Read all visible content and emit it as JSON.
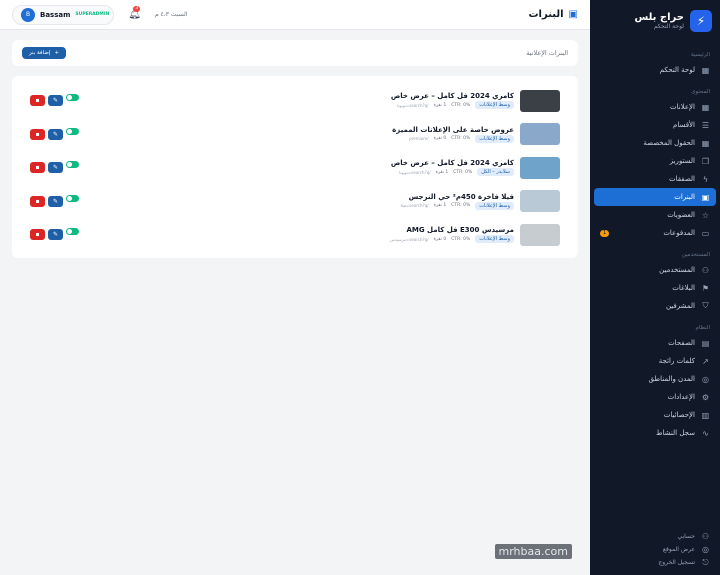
{
  "brand": {
    "name": "حراج بلس",
    "subtitle": "لوحة التحكم"
  },
  "sidebar": {
    "sections": [
      {
        "label": "الرئيسية",
        "items": [
          {
            "label": "لوحة التحكم",
            "icon": "grid-icon"
          }
        ]
      },
      {
        "label": "المحتوى",
        "items": [
          {
            "label": "الإعلانات",
            "icon": "grid-icon"
          },
          {
            "label": "الأقسام",
            "icon": "list-icon"
          },
          {
            "label": "الحقول المخصصة",
            "icon": "grid-icon"
          },
          {
            "label": "الستوريز",
            "icon": "book-icon"
          },
          {
            "label": "الصفقات",
            "icon": "lightning-icon"
          },
          {
            "label": "البنرات",
            "icon": "image-icon",
            "active": true
          },
          {
            "label": "العضويات",
            "icon": "star-icon"
          },
          {
            "label": "المدفوعات",
            "icon": "card-icon",
            "badge": "1"
          }
        ]
      },
      {
        "label": "المستخدمين",
        "items": [
          {
            "label": "المستخدمين",
            "icon": "users-icon"
          },
          {
            "label": "البلاغات",
            "icon": "flag-icon"
          },
          {
            "label": "المشرفين",
            "icon": "shield-icon"
          }
        ]
      },
      {
        "label": "النظام",
        "items": [
          {
            "label": "الصفحات",
            "icon": "file-icon"
          },
          {
            "label": "كلمات رائجة",
            "icon": "trend-icon"
          },
          {
            "label": "المدن والمناطق",
            "icon": "globe-icon"
          },
          {
            "label": "الإعدادات",
            "icon": "gear-icon"
          },
          {
            "label": "الإحصائيات",
            "icon": "chart-icon"
          },
          {
            "label": "سجل النشاط",
            "icon": "pulse-icon"
          }
        ]
      }
    ],
    "bottom": [
      {
        "label": "حسابي",
        "icon": "user-icon"
      },
      {
        "label": "عرض الموقع",
        "icon": "globe-icon"
      },
      {
        "label": "تسجيل الخروج",
        "icon": "logout-icon"
      }
    ]
  },
  "header": {
    "title": "البنرات",
    "date": "السبت ٤،٣ م",
    "notif_count": "3",
    "user_name": "Bassam",
    "user_initial": "B",
    "user_role": "SUPERADMIN"
  },
  "toolbar": {
    "title": "البنرات الإعلانية",
    "add_label": "إضافة بنر"
  },
  "banners": [
    {
      "title": "كامري 2024 فل كامل – عرض خاص",
      "tag": "وسط الإعلانات",
      "ctr": "CTR: 0%",
      "clicks": "1 نقرة",
      "slug": "/search?q=تويوتا",
      "thumb": "#3b3f46"
    },
    {
      "title": "عروض خاصة على الإعلانات المميزة",
      "tag": "وسط الإعلانات",
      "ctr": "CTR: 0%",
      "clicks": "0 نقرة",
      "slug": "/premium",
      "thumb": "#8aa8c9"
    },
    {
      "title": "كامري 2024 فل كامل – عرض خاص",
      "tag": "سلايدر – الكل",
      "ctr": "CTR: 0%",
      "clicks": "1 نقرة",
      "slug": "/search?q=تويوتا",
      "thumb": "#6fa3c9"
    },
    {
      "title": "فيلا فاخرة 450م² حي النرجس",
      "tag": "وسط الإعلانات",
      "ctr": "CTR: 0%",
      "clicks": "1 نقرة",
      "slug": "/search?q=فيلا",
      "thumb": "#b9c9d6"
    },
    {
      "title": "مرسيدس E300 فل كامل AMG",
      "tag": "وسط الإعلانات",
      "ctr": "CTR: 0%",
      "clicks": "0 نقرة",
      "slug": "/search?q=مرسيدس",
      "thumb": "#c7ccd1"
    }
  ],
  "watermark": "mrhbaa.com"
}
